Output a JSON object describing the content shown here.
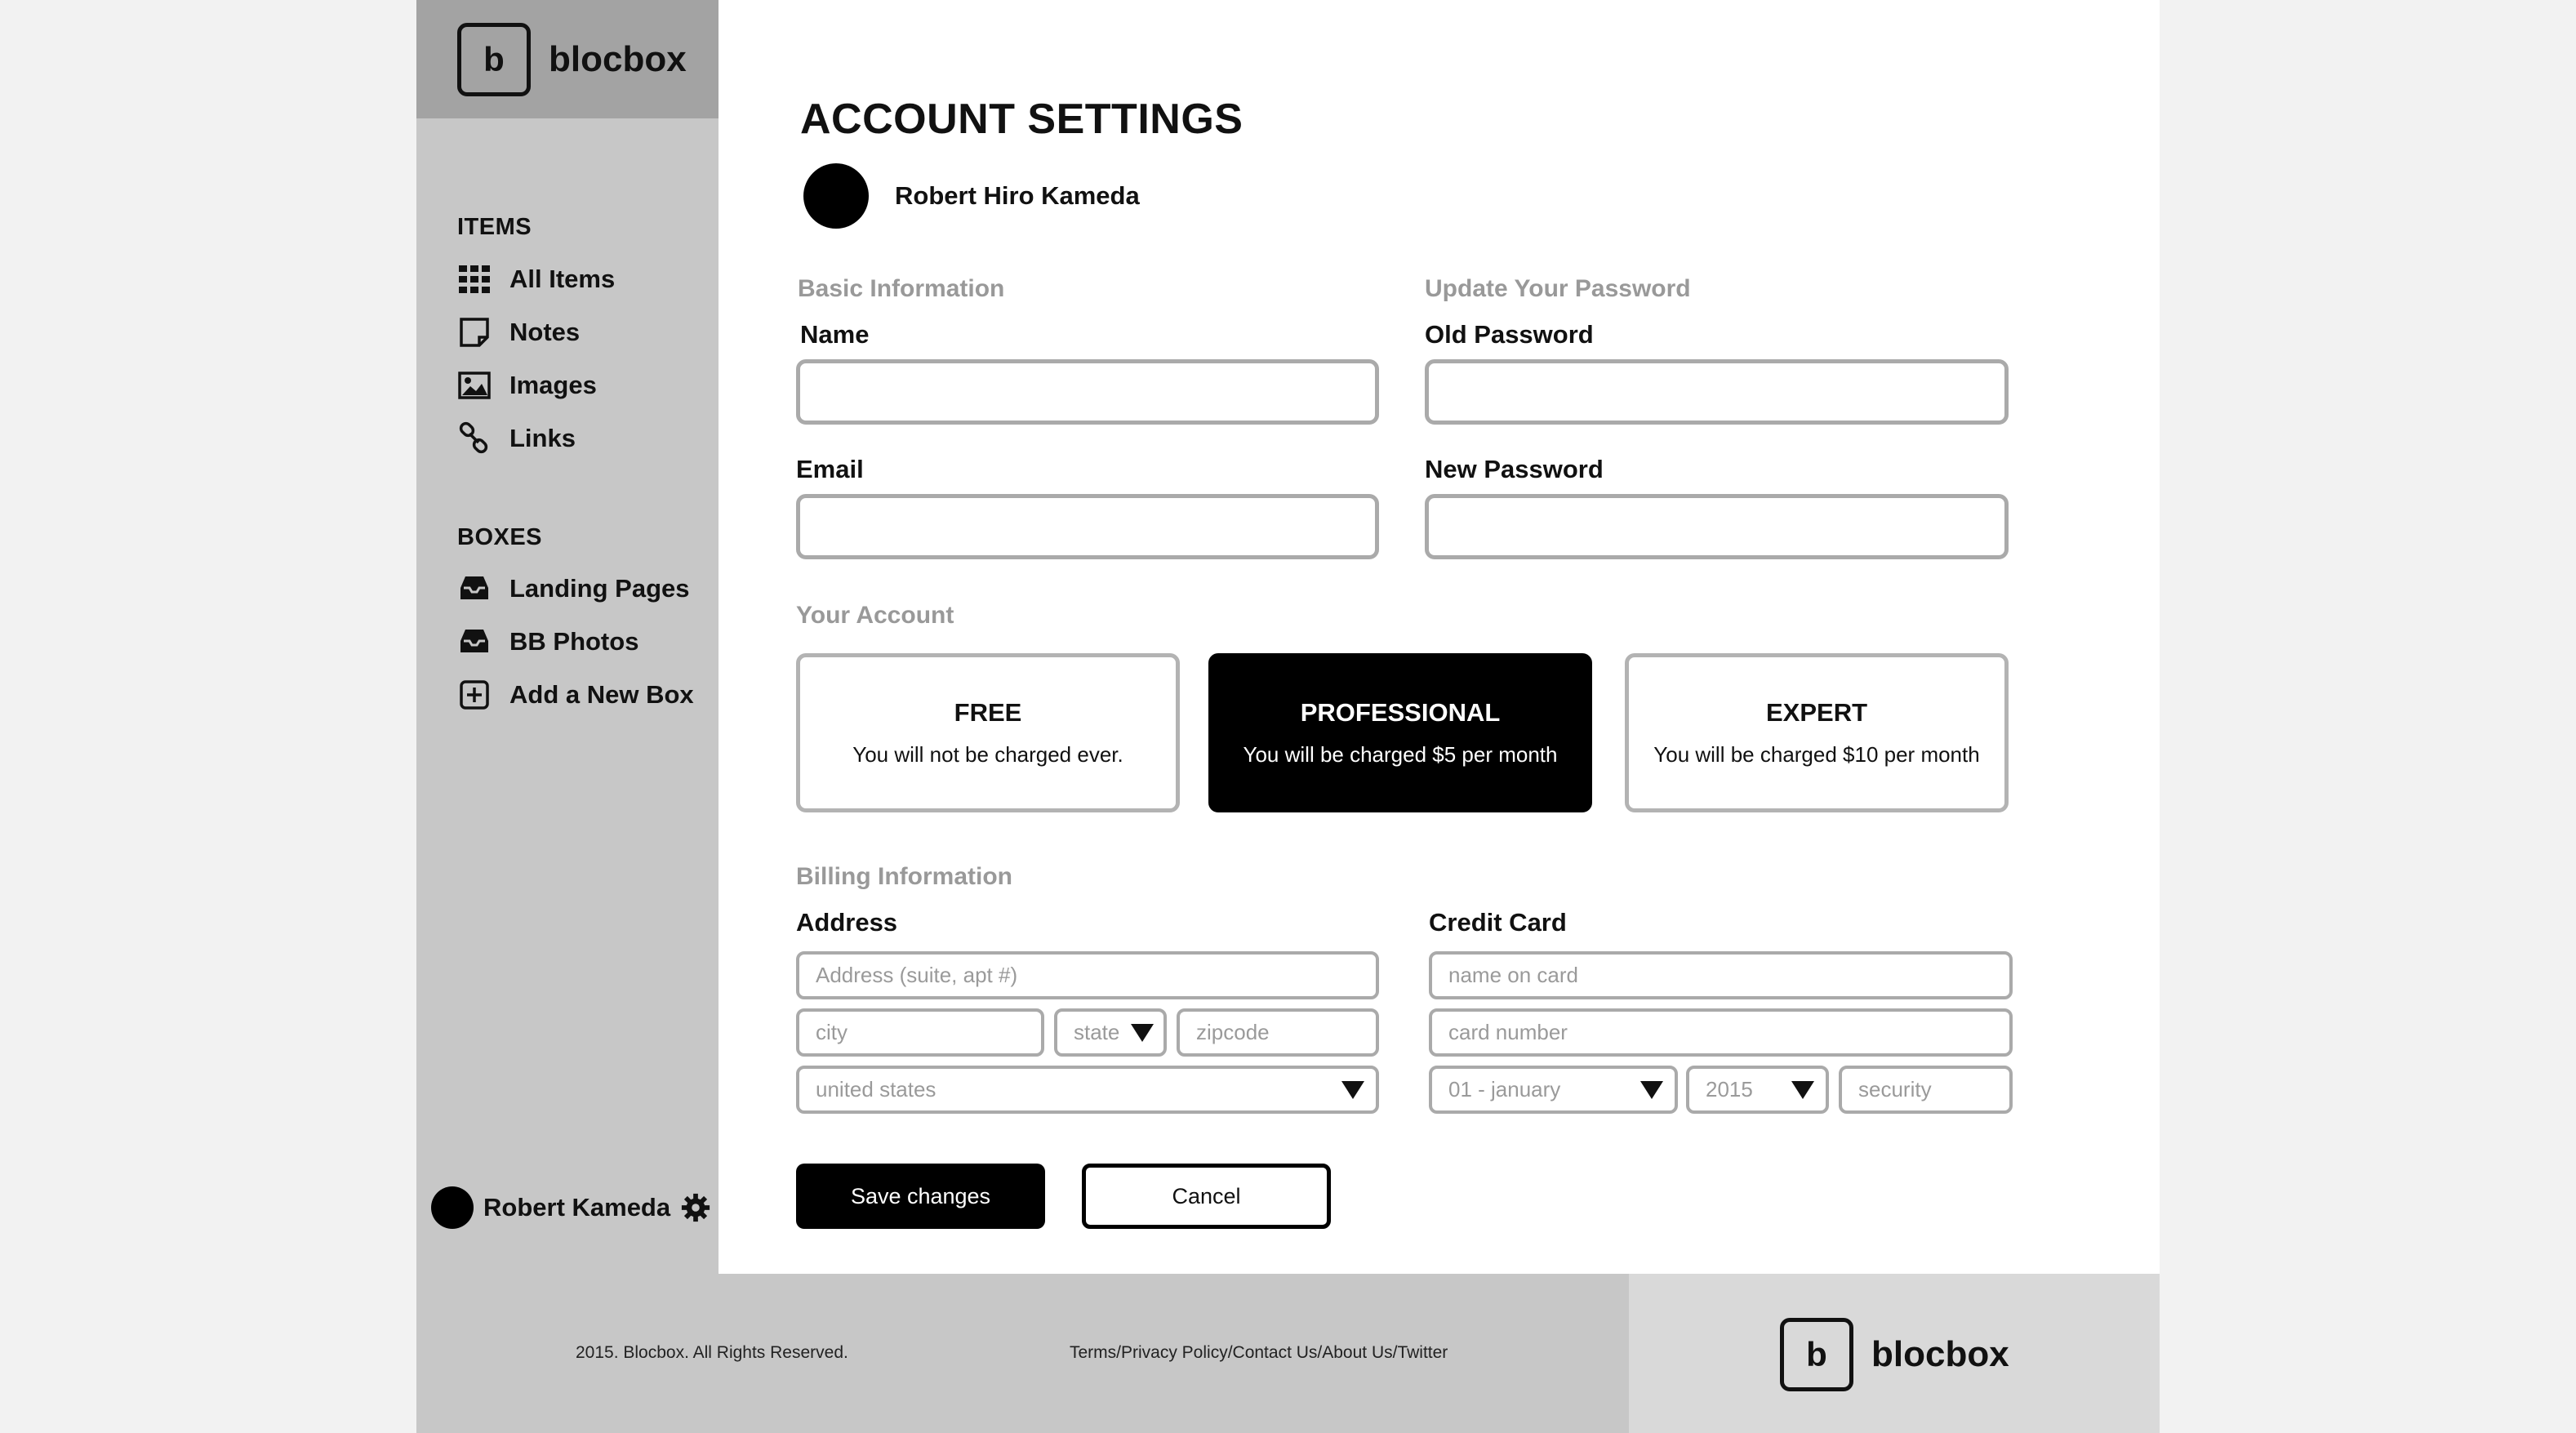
{
  "brand": {
    "logo_letter": "b",
    "name": "blocbox"
  },
  "sidebar": {
    "items_heading": "ITEMS",
    "items": [
      {
        "label": "All Items",
        "icon": "grid-icon"
      },
      {
        "label": "Notes",
        "icon": "note-icon"
      },
      {
        "label": "Images",
        "icon": "image-icon"
      },
      {
        "label": "Links",
        "icon": "link-icon"
      }
    ],
    "boxes_heading": "BOXES",
    "boxes": [
      {
        "label": "Landing Pages",
        "icon": "inbox-icon"
      },
      {
        "label": "BB Photos",
        "icon": "inbox-icon"
      },
      {
        "label": "Add a New Box",
        "icon": "plus-box-icon"
      }
    ],
    "user_name": "Robert Kameda"
  },
  "page": {
    "title": "ACCOUNT SETTINGS",
    "user_full_name": "Robert Hiro Kameda"
  },
  "basic_info": {
    "title": "Basic Information",
    "name_label": "Name",
    "email_label": "Email"
  },
  "password": {
    "title": "Update Your Password",
    "old_label": "Old Password",
    "new_label": "New Password"
  },
  "account": {
    "title": "Your Account",
    "plans": [
      {
        "name": "FREE",
        "desc": "You will not be charged ever."
      },
      {
        "name": "PROFESSIONAL",
        "desc": "You will be charged $5 per month"
      },
      {
        "name": "EXPERT",
        "desc": "You will be charged $10 per month"
      }
    ]
  },
  "billing": {
    "title": "Billing Information",
    "address_label": "Address",
    "address_placeholder": "Address (suite, apt #)",
    "city_placeholder": "city",
    "state_value": "state",
    "zip_placeholder": "zipcode",
    "country_value": "united states",
    "card_label": "Credit Card",
    "card_name_placeholder": "name on card",
    "card_number_placeholder": "card number",
    "month_value": "01 - january",
    "year_value": "2015",
    "security_placeholder": "security"
  },
  "actions": {
    "save": "Save changes",
    "cancel": "Cancel"
  },
  "footer": {
    "copyright": "2015. Blocbox. All Rights Reserved.",
    "links": "Terms/Privacy Policy/Contact Us/About Us/Twitter"
  }
}
